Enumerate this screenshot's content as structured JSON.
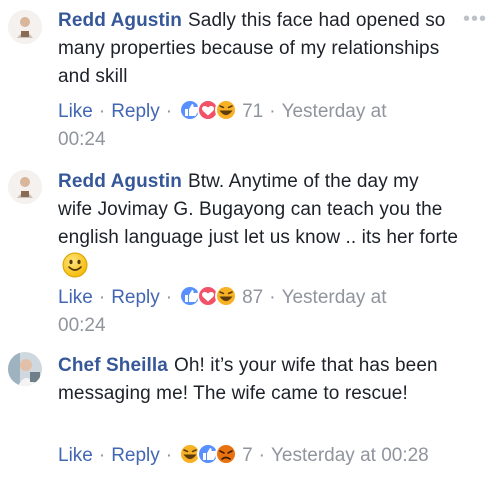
{
  "comments": [
    {
      "author": "Redd Agustin",
      "text": "Sadly this face had opened so many properties because of my relationships and skill",
      "like_label": "Like",
      "reply_label": "Reply",
      "reactions": [
        "like",
        "love",
        "haha"
      ],
      "reaction_count": "71",
      "timestamp": "Yesterday at 00:24"
    },
    {
      "author": "Redd Agustin",
      "text": "Btw. Anytime of the day my wife Jovimay G. Bugayong can teach you the english language just let us know .. its her forte",
      "like_label": "Like",
      "reply_label": "Reply",
      "reactions": [
        "like",
        "love",
        "haha"
      ],
      "reaction_count": "87",
      "timestamp": "Yesterday at 00:24"
    },
    {
      "author": "Chef Sheilla",
      "text": "Oh! it’s your wife that has been messaging me! The wife came to rescue!",
      "like_label": "Like",
      "reply_label": "Reply",
      "reactions": [
        "haha",
        "like",
        "angry"
      ],
      "reaction_count": "7",
      "timestamp": "Yesterday at 00:28"
    }
  ],
  "colors": {
    "author": "#365899",
    "link": "#4267b2",
    "meta": "#90949c",
    "like": "#5890ff",
    "love": "#f25268",
    "haha": "#f7b125",
    "angry": "#e9710f"
  },
  "icons": {
    "more": "more-options-icon",
    "inline_emoji": "smiley-icon"
  }
}
